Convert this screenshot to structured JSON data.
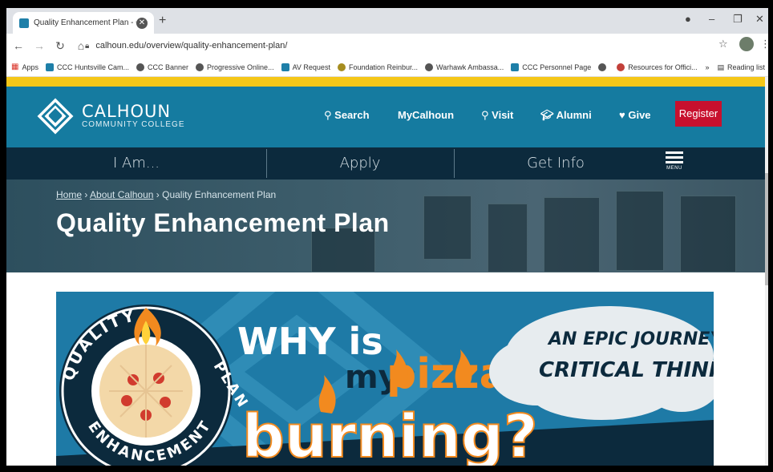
{
  "browser": {
    "tab_title": "Quality Enhancement Plan - Calh",
    "tab_close": "✕",
    "new_tab": "+",
    "url": "calhoun.edu/overview/quality-enhancement-plan/",
    "bookmarks": [
      {
        "label": "Apps",
        "icon": "apps-grid-icon"
      },
      {
        "label": "CCC Huntsville Cam...",
        "icon": "ccc-logo-icon"
      },
      {
        "label": "CCC Banner",
        "icon": "globe-icon"
      },
      {
        "label": "Progressive Online...",
        "icon": "globe-icon"
      },
      {
        "label": "AV Request",
        "icon": "ccc-logo-icon"
      },
      {
        "label": "Foundation Reinbur...",
        "icon": "foundation-icon"
      },
      {
        "label": "Warhawk Ambassa...",
        "icon": "globe-icon"
      },
      {
        "label": "CCC Personnel Page",
        "icon": "ccc-logo-icon"
      },
      {
        "label": "Resources for Offici...",
        "icon": "resource-icon"
      }
    ],
    "more_bookmarks": "»",
    "reading_list": "Reading list",
    "colors": {
      "tab_strip": "#dee1e6",
      "favicon": "#1e7fa8"
    }
  },
  "site": {
    "logo": {
      "line1": "CALHOUN",
      "line2": "COMMUNITY COLLEGE"
    },
    "nav": {
      "search": "Search",
      "mycalhoun": "MyCalhoun",
      "visit": "Visit",
      "alumni": "Alumni",
      "give": "Give",
      "register": "Register"
    },
    "subnav": {
      "iam": "I Am...",
      "apply": "Apply",
      "getinfo": "Get Info",
      "menu": "MENU"
    },
    "breadcrumb": {
      "home": "Home",
      "about": "About Calhoun",
      "current": "Quality Enhancement Plan",
      "sep": " › "
    },
    "title": "Quality Enhancement Plan",
    "banner": {
      "why": "WHY is",
      "my": "my",
      "pizza": "pizza",
      "burning": "burning?",
      "cloud_line1": "AN EPIC JOURNEY IN",
      "cloud_line2": "CRITICAL THINKING",
      "seal_top": "QUALITY",
      "seal_bottom": "ENHANCEMENT",
      "seal_right": "PLAN"
    },
    "colors": {
      "yellow_bar": "#f5c718",
      "header_blue": "#157ba0",
      "subnav_navy": "#0c2a3d",
      "register_red": "#c8102e",
      "banner_blue": "#1e7aa6",
      "flame_orange": "#f28a1f"
    }
  }
}
